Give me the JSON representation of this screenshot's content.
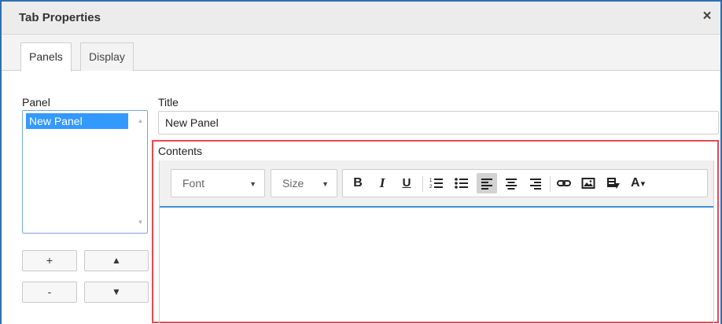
{
  "dialog": {
    "title": "Tab Properties",
    "close_icon": "×"
  },
  "tabs": [
    {
      "label": "Panels",
      "active": true
    },
    {
      "label": "Display",
      "active": false
    }
  ],
  "panel": {
    "label": "Panel",
    "items": [
      "New Panel"
    ],
    "selected": "New Panel",
    "buttons": {
      "add": "+",
      "remove": "-",
      "move_up": "▲",
      "move_down": "▼"
    }
  },
  "title_field": {
    "label": "Title",
    "value": "New Panel"
  },
  "contents": {
    "label": "Contents",
    "font_select": "Font",
    "size_select": "Size",
    "bold": "B",
    "italic": "I",
    "underline": "U",
    "text_color": "A",
    "alignment": "left"
  },
  "colors": {
    "highlight": "#e8484e",
    "selection": "#3399ff",
    "accent": "#2f6fb1"
  }
}
